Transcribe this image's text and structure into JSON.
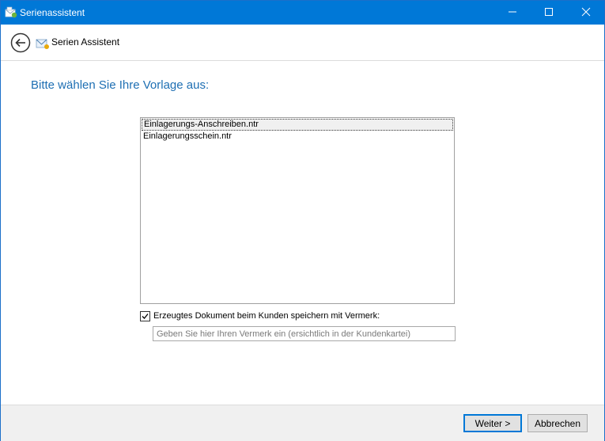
{
  "window": {
    "title": "Serienassistent",
    "icons": {
      "app": "mail-merge-icon",
      "minimize": "minimize-icon",
      "maximize": "maximize-icon",
      "close": "close-icon"
    }
  },
  "header": {
    "title": "Serien Assistent",
    "back_icon": "back-arrow-icon",
    "wizard_icon": "envelope-icon"
  },
  "content": {
    "heading": "Bitte wählen Sie Ihre Vorlage aus:",
    "templates": [
      {
        "label": "Einlagerungs-Anschreiben.ntr",
        "selected": true
      },
      {
        "label": "Einlagerungsschein.ntr",
        "selected": false
      }
    ],
    "save_checkbox": {
      "label": "Erzeugtes Dokument beim Kunden speichern mit Vermerk:",
      "checked": true
    },
    "note_input": {
      "value": "",
      "placeholder": "Geben Sie hier Ihren Vermerk ein (ersichtlich in der Kundenkartei)"
    }
  },
  "footer": {
    "next_label": "Weiter >",
    "cancel_label": "Abbrechen"
  },
  "colors": {
    "titlebar": "#0078d7",
    "heading": "#1e6fb3",
    "footer_bg": "#f0f0f0"
  }
}
